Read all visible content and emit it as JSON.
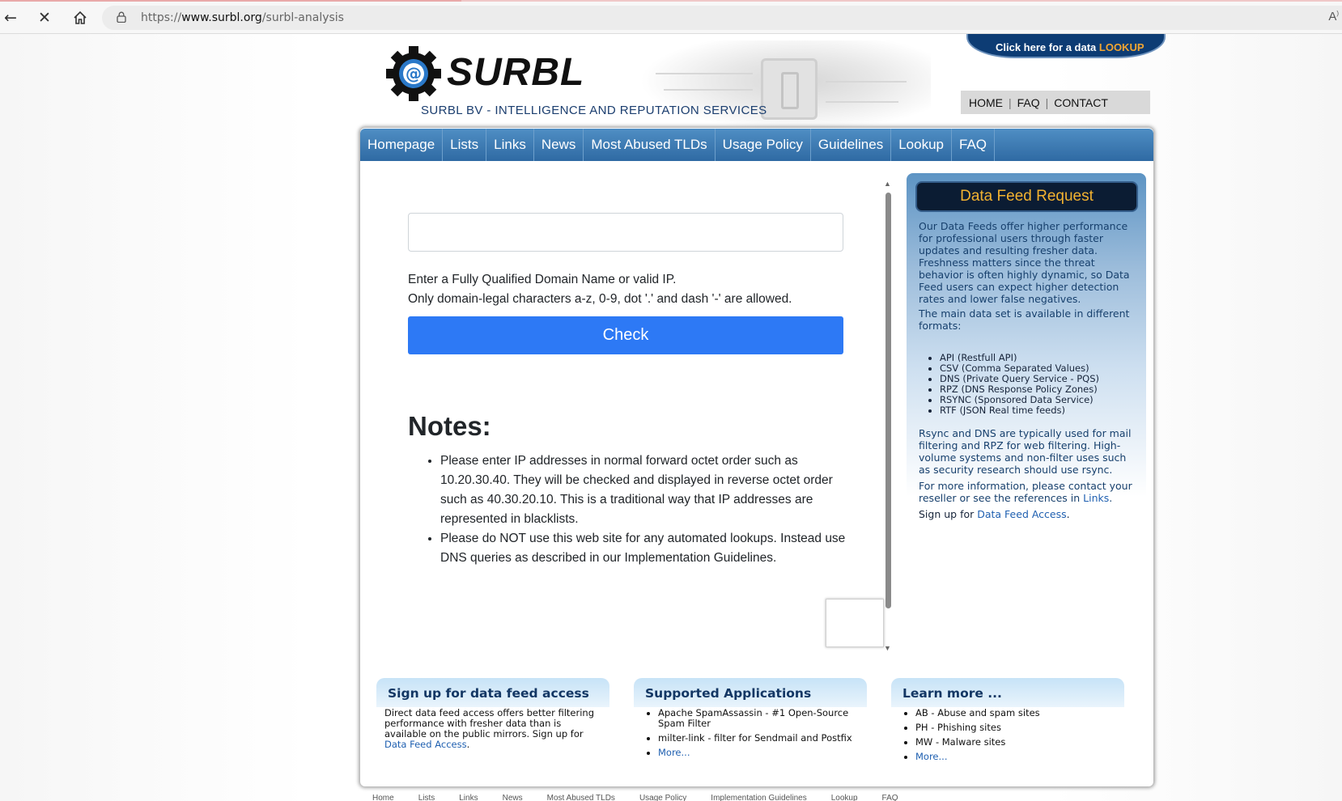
{
  "browser": {
    "url_prefix": "https://",
    "url_host": "www.surbl.org",
    "url_path": "/surbl-analysis",
    "back_icon": "back-arrow-icon",
    "stop_icon": "close-icon",
    "home_icon": "home-icon",
    "read_aloud": "A"
  },
  "header": {
    "brand": "SURBL",
    "tagline": "SURBL BV - INTELLIGENCE AND REPUTATION SERVICES",
    "lookup_prefix": "Click here for a data ",
    "lookup_word": "LOOKUP",
    "top_links": [
      "HOME",
      "FAQ",
      "CONTACT"
    ],
    "sep": "|"
  },
  "nav": {
    "items": [
      "Homepage",
      "Lists",
      "Links",
      "News",
      "Most Abused TLDs",
      "Usage Policy",
      "Guidelines",
      "Lookup",
      "FAQ"
    ]
  },
  "form": {
    "input_value": "",
    "help_line1": "Enter a Fully Qualified Domain Name or valid IP.",
    "help_line2": "Only domain-legal characters a-z, 0-9, dot '.' and dash '-' are allowed.",
    "check_label": "Check"
  },
  "notes": {
    "title": "Notes:",
    "items": [
      "Please enter IP addresses in normal forward octet order such as 10.20.30.40. They will be checked and displayed in reverse octet order such as 40.30.20.10. This is a traditional way that IP addresses are represented in blacklists.",
      "Please do NOT use this web site for any automated lookups. Instead use DNS queries as described in our Implementation Guidelines."
    ]
  },
  "sidebar": {
    "title": "Data Feed Request",
    "para1": "Our Data Feeds offer higher performance for professional users through faster updates and resulting fresher data. Freshness matters since the threat behavior is often highly dynamic, so Data Feed users can expect higher detection rates and lower false negatives.",
    "para2": "The main data set is available in different formats:",
    "formats": [
      "API (Restfull API)",
      "CSV (Comma Separated Values)",
      "DNS (Private Query Service - PQS)",
      "RPZ (DNS Response Policy Zones)",
      "RSYNC (Sponsored Data Service)",
      "RTF (JSON Real time feeds)"
    ],
    "para3": "Rsync and DNS are typically used for mail filtering and RPZ for web filtering. High-volume systems and non-filter uses such as security research should use rsync.",
    "para4_prefix": "For more information, please contact your reseller or see the references in ",
    "para4_link": "Links",
    "para4_suffix": ".",
    "para5_prefix": "Sign up for ",
    "para5_link": "Data Feed Access",
    "para5_suffix": "."
  },
  "footer_boxes": {
    "signup": {
      "title": "Sign up for data feed access",
      "text_prefix": "Direct data feed access offers better filtering performance with fresher data than is available on the public mirrors. Sign up for ",
      "link": "Data Feed Access",
      "text_suffix": "."
    },
    "apps": {
      "title": "Supported Applications",
      "items": [
        "Apache SpamAssassin - #1 Open-Source Spam Filter",
        "milter-link - filter for Sendmail and Postfix"
      ],
      "more": "More..."
    },
    "learn": {
      "title": "Learn more ...",
      "items": [
        "AB - Abuse and spam sites",
        "PH - Phishing sites",
        "MW - Malware sites"
      ],
      "more": "More..."
    }
  },
  "bottom_links": [
    "Home",
    "Lists",
    "Links",
    "News",
    "Most Abused TLDs",
    "Usage Policy",
    "Implementation Guidelines",
    "Lookup",
    "FAQ"
  ],
  "colors": {
    "nav_blue": "#2f6aa3",
    "check_blue": "#2d79f5",
    "sidebar_title": "#f2b230",
    "lookup_accent": "#f2a531"
  }
}
